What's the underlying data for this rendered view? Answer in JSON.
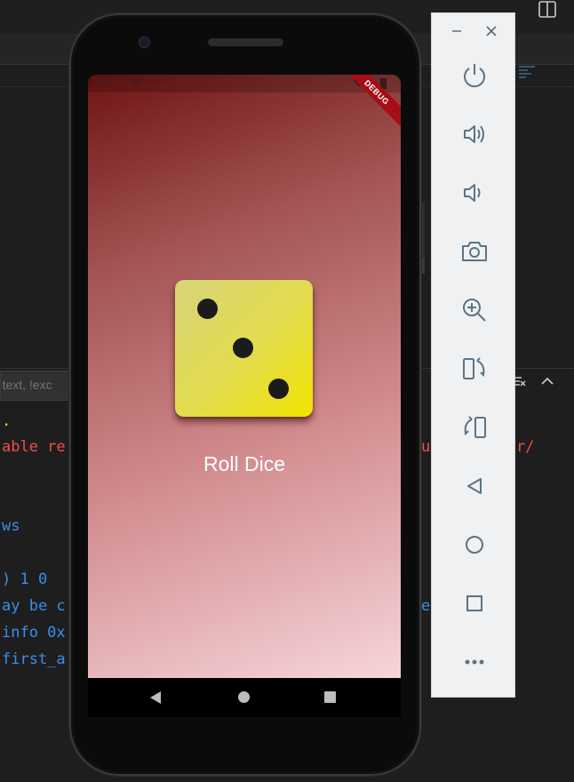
{
  "phone_app": {
    "status_time": "5:26",
    "debug_banner": "DEBUG",
    "roll_label": "Roll Dice",
    "dice_value": 3
  },
  "vscode": {
    "filter_placeholder": "g. text, !exc",
    "terminal_lines": [
      {
        "text": ".",
        "color": "yellow"
      },
      {
        "text": "able re",
        "color": "red"
      },
      {
        "text": "ws",
        "color": "blue"
      },
      {
        "text": ") 1 0",
        "color": "blue"
      },
      {
        "text": "ay be c",
        "color": "blue"
      },
      {
        "text": "info 0x",
        "color": "blue"
      },
      {
        "text": "first_a",
        "color": "blue"
      }
    ],
    "terminal_right": [
      {
        "text": "u",
        "color": "red"
      },
      {
        "text": "utter/",
        "color": "red"
      },
      {
        "text": "e",
        "color": "blue"
      }
    ]
  },
  "emulator_toolbar": {
    "buttons": [
      {
        "name": "power-button",
        "icon": "power-icon"
      },
      {
        "name": "volume-up-button",
        "icon": "volume-up-icon"
      },
      {
        "name": "volume-down-button",
        "icon": "volume-down-icon"
      },
      {
        "name": "screenshot-button",
        "icon": "camera-icon"
      },
      {
        "name": "zoom-button",
        "icon": "zoom-in-icon"
      },
      {
        "name": "rotate-left-button",
        "icon": "rotate-left-icon"
      },
      {
        "name": "rotate-right-button",
        "icon": "rotate-right-icon"
      },
      {
        "name": "back-button",
        "icon": "back-icon"
      },
      {
        "name": "home-button",
        "icon": "home-icon"
      },
      {
        "name": "overview-button",
        "icon": "overview-icon"
      },
      {
        "name": "more-button",
        "icon": "more-icon"
      }
    ]
  },
  "colors": {
    "accent_red": "#a50e16",
    "dice_yellow": "#f2e400",
    "toolbar_icon": "#5a7486"
  }
}
